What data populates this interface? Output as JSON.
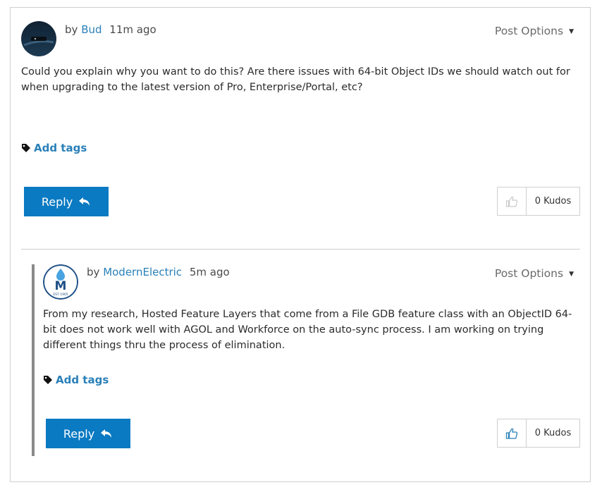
{
  "posts": [
    {
      "by_prefix": "by",
      "author": "Bud",
      "time": "11m ago",
      "post_options": "Post Options",
      "body": "Could you explain why you want to do this? Are there issues with 64-bit Object IDs we should watch out for when upgrading to the latest version of Pro, Enterprise/Portal, etc?",
      "add_tags": "Add tags",
      "reply": "Reply",
      "kudos": "0 Kudos"
    },
    {
      "by_prefix": "by",
      "author": "ModernElectric",
      "time": "5m ago",
      "post_options": "Post Options",
      "body": "From my research, Hosted Feature Layers that come from a File GDB feature class with an ObjectID 64-bit does not work well with AGOL and Workforce on the auto-sync process. I am working on trying different things thru the process of elimination.",
      "add_tags": "Add tags",
      "reply": "Reply",
      "kudos": "0 Kudos",
      "avatar_logo": {
        "letter": "M",
        "text": "EST 1905"
      }
    }
  ],
  "colors": {
    "link": "#2a80b9",
    "reply_button": "#0a7ac2",
    "border": "#cfcfcf",
    "thread_bar": "#8a8a8a"
  },
  "icons": [
    "tag-icon",
    "reply-arrow-icon",
    "thumbs-up-icon",
    "caret-down-icon"
  ]
}
